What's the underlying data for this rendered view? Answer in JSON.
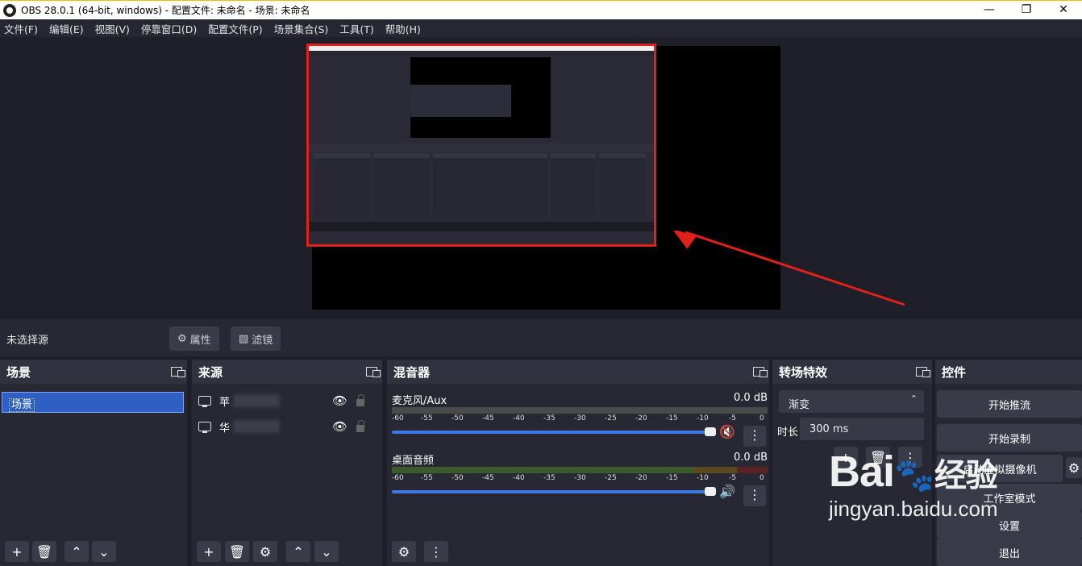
{
  "window": {
    "title": "OBS 28.0.1 (64-bit, windows) - 配置文件: 未命名 - 场景: 未命名",
    "minimize": "—",
    "maximize": "❐",
    "close": "✕"
  },
  "menu": [
    "文件(F)",
    "编辑(E)",
    "视图(V)",
    "停靠窗口(D)",
    "配置文件(P)",
    "场景集合(S)",
    "工具(T)",
    "帮助(H)"
  ],
  "source_bar": {
    "no_source": "未选择源",
    "properties": "属性",
    "filters": "滤镜"
  },
  "scenes": {
    "title": "场景",
    "items": [
      "场景"
    ]
  },
  "sources": {
    "title": "来源",
    "items": [
      {
        "name": "苹",
        "icon": "monitor-icon"
      },
      {
        "name": "华",
        "icon": "monitor-icon"
      }
    ]
  },
  "mixer": {
    "title": "混音器",
    "tracks": [
      {
        "name": "麦克风/Aux",
        "db": "0.0 dB",
        "muted": true
      },
      {
        "name": "桌面音频",
        "db": "0.0 dB",
        "muted": false
      }
    ],
    "scale": [
      "-60",
      "-55",
      "-50",
      "-45",
      "-40",
      "-35",
      "-30",
      "-25",
      "-20",
      "-15",
      "-10",
      "-5",
      "0"
    ]
  },
  "transitions": {
    "title": "转场特效",
    "selected": "渐变",
    "duration_label": "时长",
    "duration_value": "300 ms"
  },
  "controls": {
    "title": "控件",
    "buttons": [
      "开始推流",
      "开始录制",
      "启动虚拟摄像机",
      "工作室模式",
      "设置",
      "退出"
    ]
  },
  "watermark": {
    "brand": "Bai",
    "brand2": "经验",
    "url": "jingyan.baidu.com"
  },
  "colors": {
    "highlight_border": "#e0201a",
    "arrow": "#e0201a",
    "accent_blue": "#3b79e6",
    "muted_red": "#d23a3a"
  }
}
